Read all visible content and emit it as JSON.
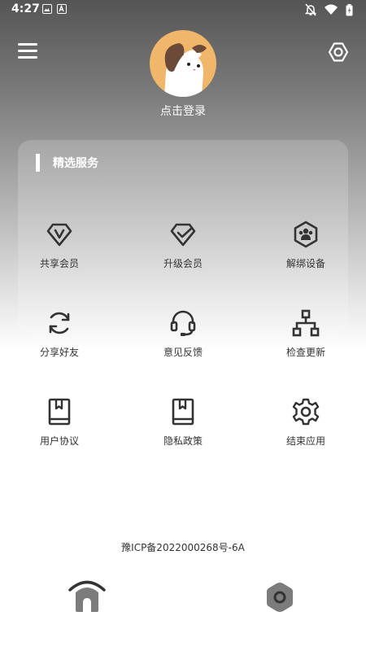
{
  "status_bar": {
    "time": "4:27",
    "icons_left": [
      "image-icon",
      "text-a-icon"
    ],
    "icons_right": [
      "mute-icon",
      "wifi-icon",
      "battery-icon"
    ]
  },
  "header": {
    "menu_icon": "hamburger-menu-icon",
    "settings_icon": "hexagon-settings-icon",
    "avatar": "dog-avatar",
    "login_text": "点击登录"
  },
  "services": {
    "title": "精选服务",
    "items": [
      {
        "label": "共享会员",
        "icon": "diamond-v-icon"
      },
      {
        "label": "升级会员",
        "icon": "diamond-check-icon"
      },
      {
        "label": "解绑设备",
        "icon": "hexagon-users-icon"
      },
      {
        "label": "分享好友",
        "icon": "refresh-icon"
      },
      {
        "label": "意见反馈",
        "icon": "headset-icon"
      },
      {
        "label": "检查更新",
        "icon": "network-icon"
      },
      {
        "label": "用户协议",
        "icon": "book-icon"
      },
      {
        "label": "隐私政策",
        "icon": "book-icon"
      },
      {
        "label": "结束应用",
        "icon": "gear-icon"
      }
    ]
  },
  "footer": {
    "icp": "豫ICP备2022000268号-6A"
  },
  "bottom_nav": {
    "home_icon": "home-icon",
    "settings_icon": "hexagon-settings-icon"
  },
  "colors": {
    "header_gradient_top": "#555555",
    "icon_dark": "#333333",
    "avatar_bg": "#f0b66a",
    "nav_icon": "#7c7c7c"
  }
}
